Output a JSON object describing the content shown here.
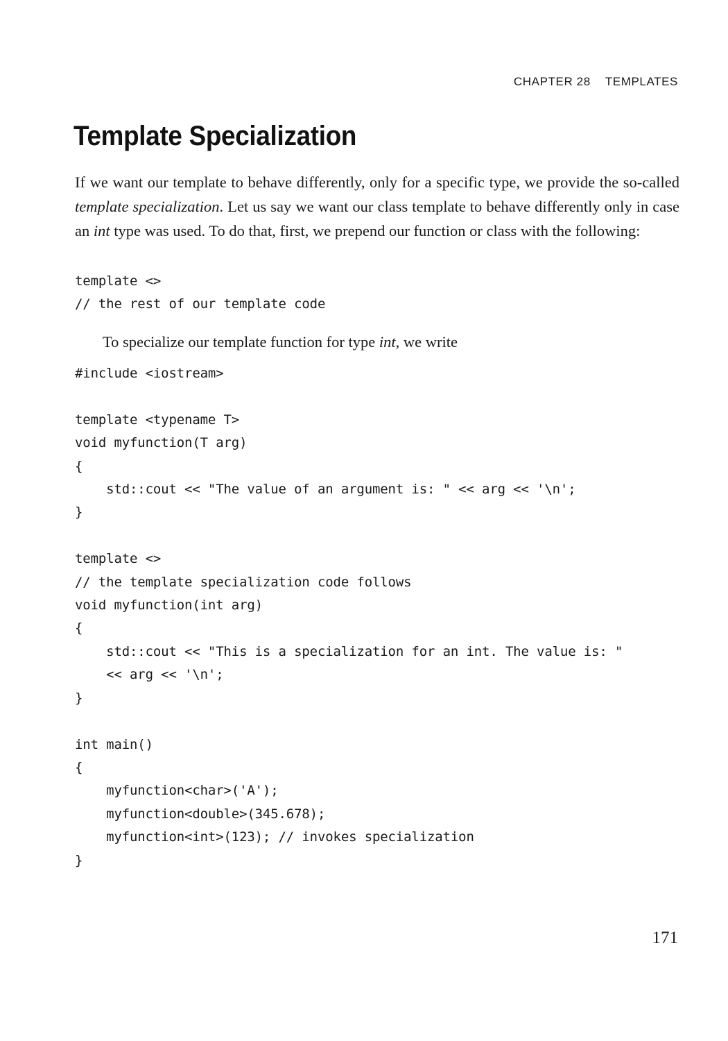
{
  "page": {
    "running_head": "CHAPTER 28    TEMPLATES",
    "title": "Template Specialization",
    "folio": "171"
  },
  "paragraphs": {
    "intro_part1": "If we want our template to behave differently, only for a specific type, we provide the so-called ",
    "intro_em1": "template specialization",
    "intro_part2": ". Let us say we want our class template to behave differently only in case an ",
    "intro_em2": "int",
    "intro_part3": " type was used. To do that, first, we prepend our function or class with the following:",
    "specialize_part1": "To specialize our template function for type ",
    "specialize_em1": "int",
    "specialize_part2": ", we write"
  },
  "code_blocks": {
    "first": "template <>\n// the rest of our template code",
    "second": "#include <iostream>\n\ntemplate <typename T>\nvoid myfunction(T arg)\n{\n    std::cout << \"The value of an argument is: \" << arg << '\\n';\n}\n\ntemplate <>\n// the template specialization code follows\nvoid myfunction(int arg)\n{\n    std::cout << \"This is a specialization for an int. The value is: \"\n    << arg << '\\n';\n}\n\nint main()\n{\n    myfunction<char>('A');\n    myfunction<double>(345.678);\n    myfunction<int>(123); // invokes specialization\n}"
  }
}
